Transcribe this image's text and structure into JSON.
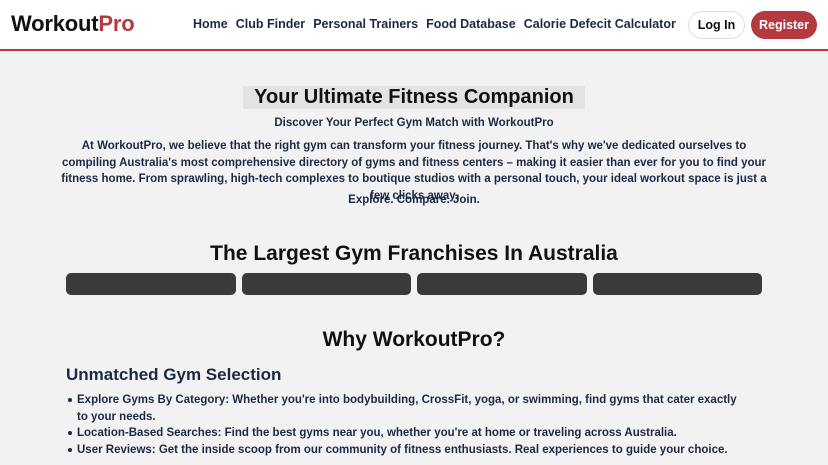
{
  "header": {
    "logo": {
      "part1": "Workout",
      "part2": "Pro"
    },
    "nav": [
      {
        "label": "Home"
      },
      {
        "label": "Club Finder"
      },
      {
        "label": "Personal Trainers"
      },
      {
        "label": "Food Database"
      },
      {
        "label": "Calorie Defecit Calculator"
      }
    ],
    "login_label": "Log In",
    "register_label": "Register"
  },
  "hero": {
    "title": "Your Ultimate Fitness Companion",
    "subtitle": "Discover Your Perfect Gym Match with WorkoutPro",
    "paragraph": "At WorkoutPro, we believe that the right gym can transform your fitness journey. That's why we've dedicated ourselves to compiling Australia's most comprehensive directory of gyms and fitness centers – making it easier than ever for you to find your fitness home. From sprawling, high-tech complexes to boutique studios with a personal touch, your ideal workout space is just a few clicks away.",
    "tagline": "Explore. Compare. Join."
  },
  "franchises": {
    "title": "The Largest Gym Franchises In Australia",
    "cards": 4
  },
  "why": {
    "title": "Why WorkoutPro?",
    "section_heading": "Unmatched Gym Selection",
    "items": [
      "Explore Gyms By Category: Whether you're into bodybuilding, CrossFit, yoga, or swimming, find gyms that cater exactly to your needs.",
      "Location-Based Searches: Find the best gyms near you, whether you're at home or traveling across Australia.",
      "User Reviews: Get the inside scoop from our community of fitness enthusiasts. Real experiences to guide your choice."
    ]
  },
  "colors": {
    "brand": "#b5393f",
    "page_bg": "#f2f2f2",
    "card_bg": "#3a3a3a",
    "text": "#1b2a44"
  }
}
